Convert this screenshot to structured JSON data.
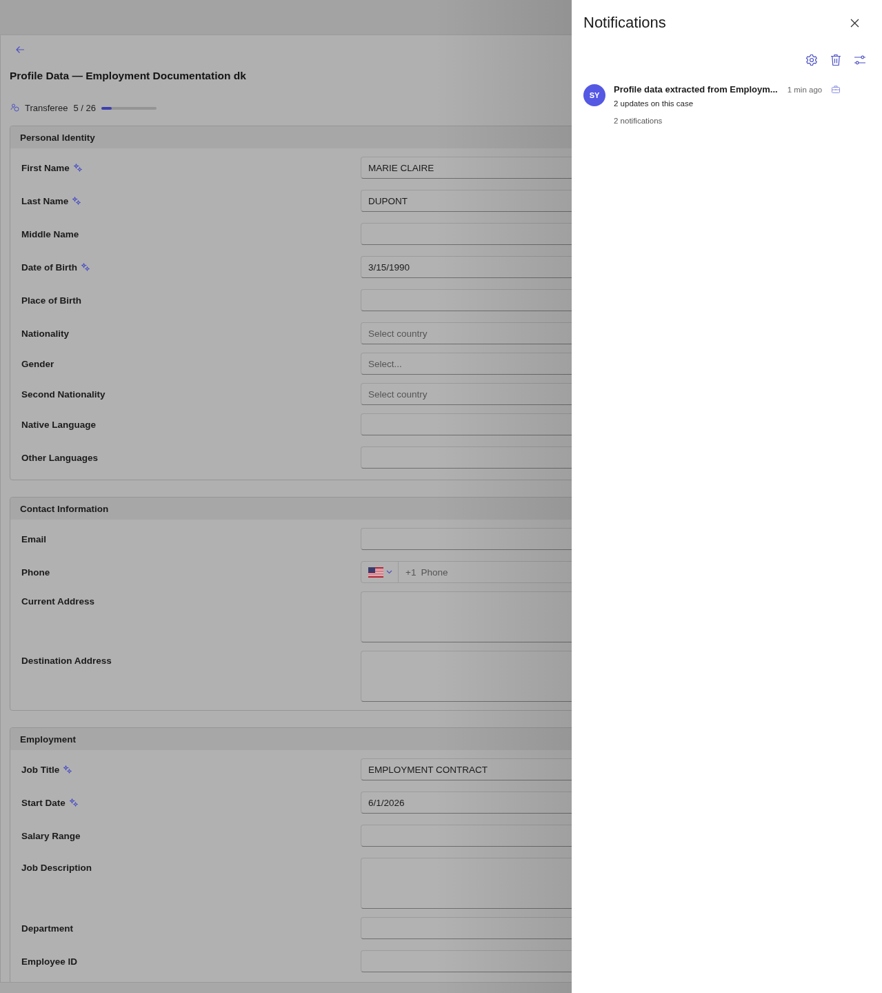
{
  "page": {
    "title": "Profile Data — Employment Documentation dk",
    "role": "Transferee",
    "progress_text": "5 / 26",
    "progress": {
      "level": 0.19
    }
  },
  "sections": [
    {
      "title": "Personal Identity",
      "fields": [
        {
          "label": "First Name",
          "kind": "text",
          "ai_extracted": true,
          "value": "MARIE CLAIRE"
        },
        {
          "label": "Last Name",
          "kind": "text",
          "ai_extracted": true,
          "value": "DUPONT"
        },
        {
          "label": "Middle Name",
          "kind": "text",
          "ai_extracted": false
        },
        {
          "label": "Date of Birth",
          "kind": "text",
          "ai_extracted": true,
          "value": "3/15/1990"
        },
        {
          "label": "Place of Birth",
          "kind": "text",
          "ai_extracted": false
        },
        {
          "label": "Nationality",
          "kind": "select",
          "ai_extracted": false,
          "placeholder": "Select country"
        },
        {
          "label": "Gender",
          "kind": "select",
          "ai_extracted": false,
          "placeholder": "Select..."
        },
        {
          "label": "Second Nationality",
          "kind": "select",
          "ai_extracted": false,
          "placeholder": "Select country"
        },
        {
          "label": "Native Language",
          "kind": "text",
          "ai_extracted": false
        },
        {
          "label": "Other Languages",
          "kind": "text",
          "ai_extracted": false
        }
      ]
    },
    {
      "title": "Contact Information",
      "fields": [
        {
          "label": "Email",
          "kind": "text",
          "ai_extracted": false
        },
        {
          "label": "Phone",
          "kind": "phone",
          "ai_extracted": false,
          "prefix": "+1",
          "placeholder": "Phone"
        },
        {
          "label": "Current Address",
          "kind": "textarea",
          "ai_extracted": false
        },
        {
          "label": "Destination Address",
          "kind": "textarea",
          "ai_extracted": false
        }
      ]
    },
    {
      "title": "Employment",
      "fields": [
        {
          "label": "Job Title",
          "kind": "text",
          "ai_extracted": true,
          "value": "EMPLOYMENT CONTRACT"
        },
        {
          "label": "Start Date",
          "kind": "text",
          "ai_extracted": true,
          "value": "6/1/2026"
        },
        {
          "label": "Salary Range",
          "kind": "text",
          "ai_extracted": false
        },
        {
          "label": "Job Description",
          "kind": "textarea",
          "ai_extracted": false
        },
        {
          "label": "Department",
          "kind": "text",
          "ai_extracted": false
        },
        {
          "label": "Employee ID",
          "kind": "text",
          "ai_extracted": false
        }
      ]
    }
  ],
  "notifications": {
    "title": "Notifications",
    "items": [
      {
        "avatar": "SY",
        "title": "Profile data extracted from Employm...",
        "time": "1 min ago",
        "subtitle": "2 updates on this case",
        "count": "2 notifications"
      }
    ]
  }
}
